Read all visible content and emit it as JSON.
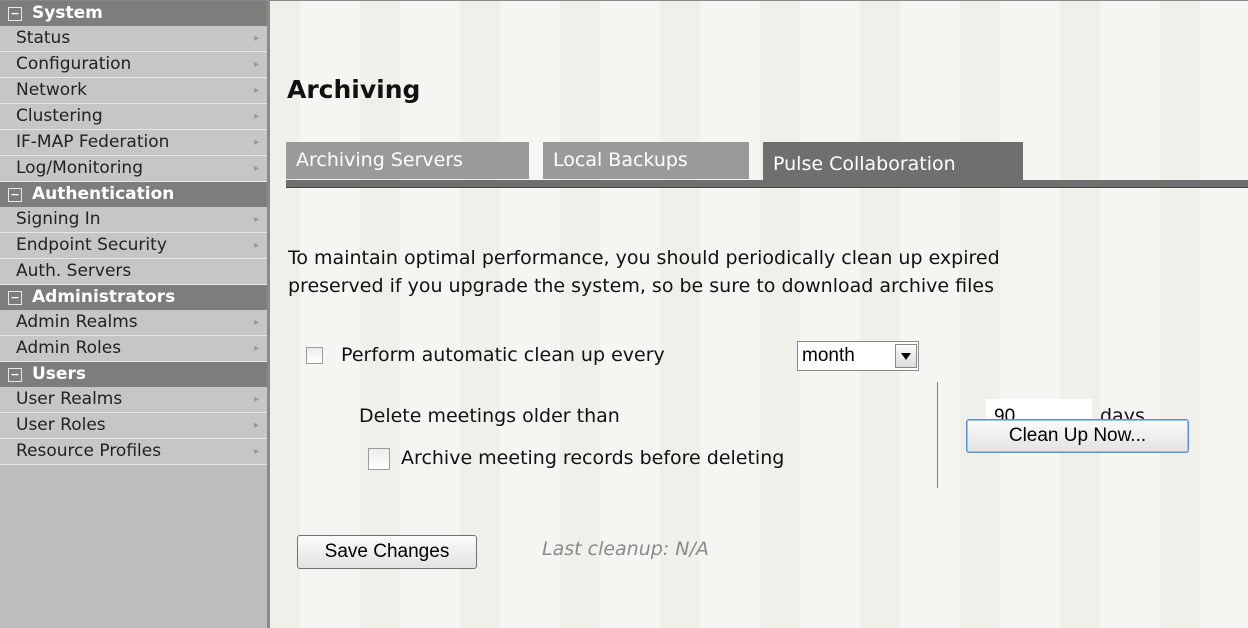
{
  "sidebar": {
    "sections": [
      {
        "title": "System",
        "items": [
          {
            "label": "Status",
            "arrow": true
          },
          {
            "label": "Configuration",
            "arrow": true
          },
          {
            "label": "Network",
            "arrow": true
          },
          {
            "label": "Clustering",
            "arrow": true
          },
          {
            "label": "IF-MAP Federation",
            "arrow": true
          },
          {
            "label": "Log/Monitoring",
            "arrow": true
          }
        ]
      },
      {
        "title": "Authentication",
        "items": [
          {
            "label": "Signing In",
            "arrow": true
          },
          {
            "label": "Endpoint Security",
            "arrow": true
          },
          {
            "label": "Auth. Servers",
            "arrow": false
          }
        ]
      },
      {
        "title": "Administrators",
        "items": [
          {
            "label": "Admin Realms",
            "arrow": true
          },
          {
            "label": "Admin Roles",
            "arrow": true
          }
        ]
      },
      {
        "title": "Users",
        "items": [
          {
            "label": "User Realms",
            "arrow": true
          },
          {
            "label": "User Roles",
            "arrow": true
          },
          {
            "label": "Resource Profiles",
            "arrow": true
          }
        ]
      }
    ],
    "collapse_glyph": "−",
    "arrow_glyph": "▸"
  },
  "page": {
    "title": "Archiving",
    "tabs": [
      {
        "label": "Archiving Servers",
        "active": false
      },
      {
        "label": "Local Backups",
        "active": false
      },
      {
        "label": "Pulse Collaboration",
        "active": true
      }
    ],
    "description_line1": "To maintain optimal performance, you should periodically clean up expired",
    "description_line2": "preserved if you upgrade the system, so be sure to download archive files"
  },
  "cleanup": {
    "auto_label": "Perform automatic clean up every",
    "auto_checked": false,
    "interval_value": "month",
    "delete_label": "Delete meetings older than",
    "days_value": "90",
    "days_unit": "days",
    "archive_label": "Archive meeting records before deleting",
    "archive_checked": false,
    "clean_now_label": "Clean Up Now...",
    "save_label": "Save Changes",
    "last_cleanup": "Last cleanup: N/A"
  }
}
